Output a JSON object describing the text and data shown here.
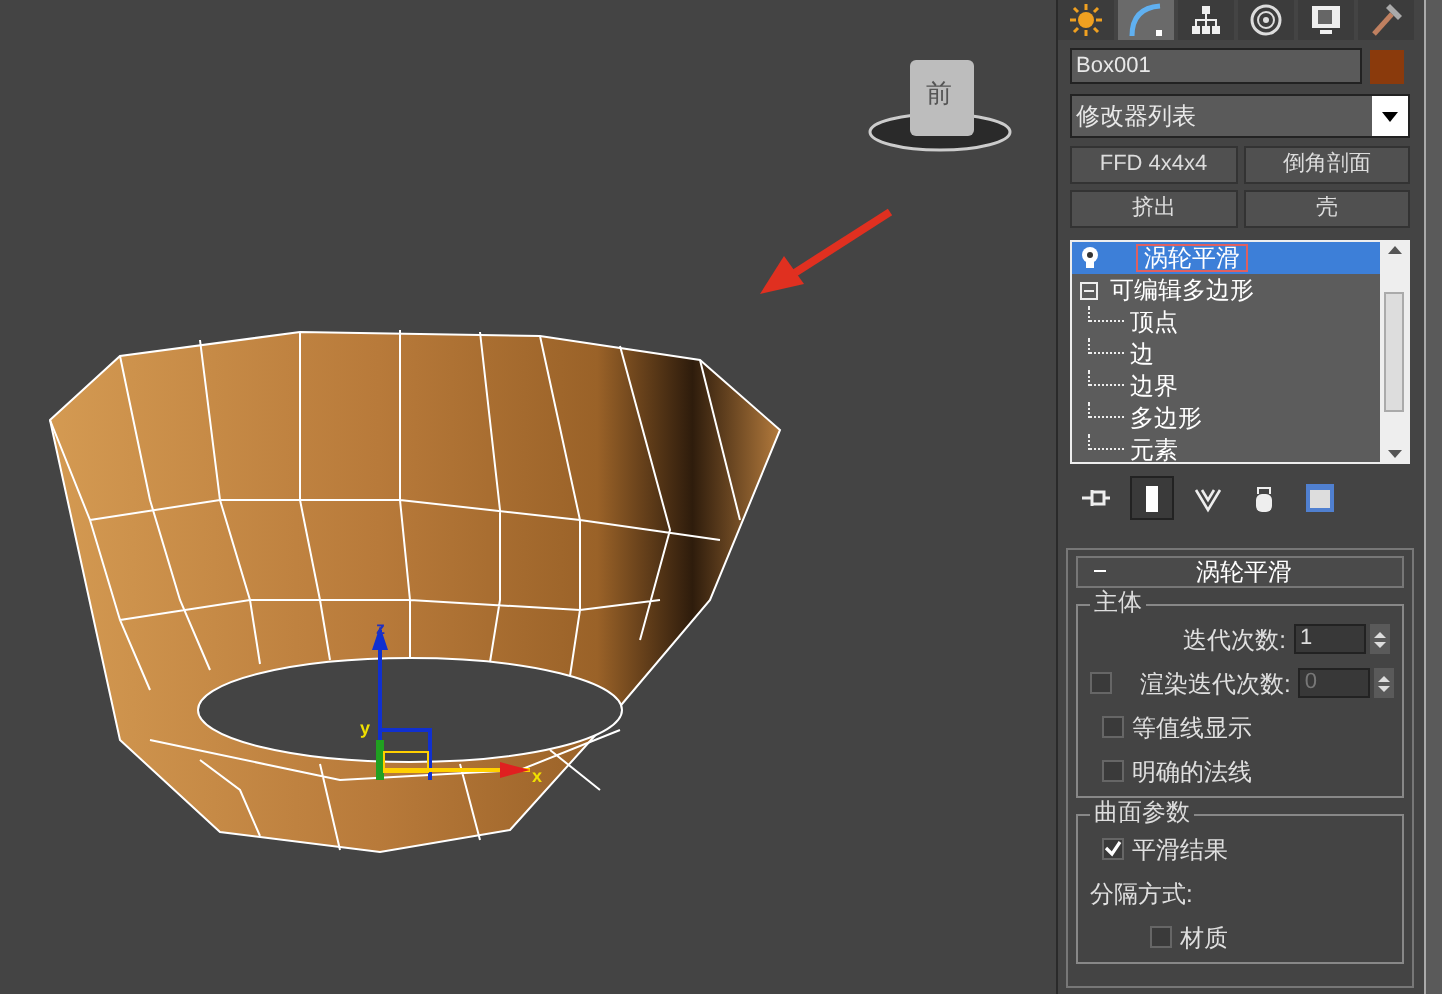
{
  "viewport": {
    "viewcube_label": "前",
    "gizmo_axes": [
      "z",
      "y",
      "x"
    ]
  },
  "command_panel": {
    "tabs": [
      {
        "kind": "create",
        "selected": false
      },
      {
        "kind": "modify",
        "selected": true
      },
      {
        "kind": "hierarchy",
        "selected": false
      },
      {
        "kind": "motion",
        "selected": false
      },
      {
        "kind": "display",
        "selected": false
      },
      {
        "kind": "utilities",
        "selected": false
      }
    ],
    "object_name": "Box001",
    "modifier_list": "修改器列表",
    "modifier_buttons": [
      "FFD 4x4x4",
      "倒角剖面",
      "挤出",
      "壳"
    ],
    "stack": [
      {
        "label": "涡轮平滑",
        "selected": true
      },
      {
        "label": "可编辑多边形",
        "selected": false,
        "expanded": true,
        "children": [
          {
            "label": "顶点"
          },
          {
            "label": "边"
          },
          {
            "label": "边界"
          },
          {
            "label": "多边形"
          },
          {
            "label": "元素"
          }
        ]
      }
    ],
    "stack_tools": [
      {
        "kind": "pin",
        "selected": false
      },
      {
        "kind": "end-result",
        "selected": true
      },
      {
        "kind": "unique",
        "selected": false
      },
      {
        "kind": "remove",
        "selected": false
      },
      {
        "kind": "configure",
        "selected": false
      }
    ],
    "rollout": {
      "title": "涡轮平滑",
      "groups": [
        {
          "label": "主体",
          "rows": [
            {
              "kind": "spinner",
              "label": "迭代次数:",
              "value": "1"
            },
            {
              "kind": "check-spinner",
              "label": "渲染迭代次数:",
              "value": "0",
              "checked": false,
              "disabled": true
            },
            {
              "kind": "checkbox",
              "label": "等值线显示",
              "checked": false
            },
            {
              "kind": "checkbox",
              "label": "明确的法线",
              "checked": false
            }
          ]
        },
        {
          "label": "曲面参数",
          "rows": [
            {
              "kind": "checkbox",
              "label": "平滑结果",
              "checked": true
            },
            {
              "kind": "text",
              "label": "分隔方式:"
            },
            {
              "kind": "subcheckbox",
              "label": "材质",
              "checked": false
            }
          ]
        }
      ]
    }
  }
}
